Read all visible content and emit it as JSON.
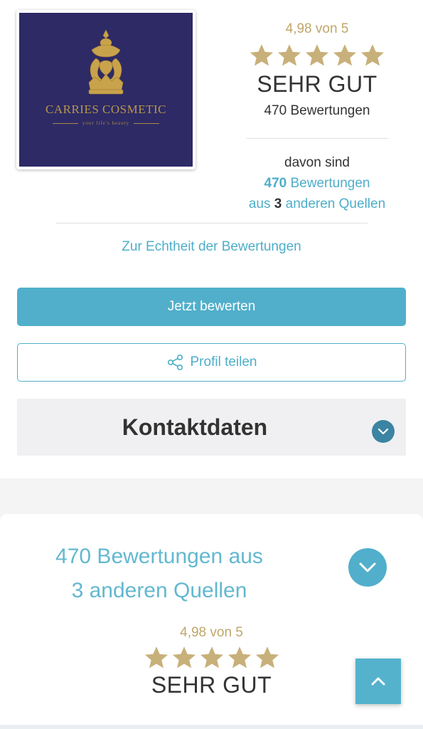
{
  "logo": {
    "brand_name": "CARRIES COSMETIC",
    "tagline": "your life's beauty",
    "accent_color": "#b8964a",
    "background_color": "#2d2a66"
  },
  "rating": {
    "score_text": "4,98 von 5",
    "stars": 5,
    "verdict": "SEHR GUT",
    "count_text": "470 Bewertungen"
  },
  "sources": {
    "intro": "davon sind",
    "count": "470",
    "reviews_word": "Bewertungen",
    "prefix": "aus",
    "source_count": "3",
    "suffix": "anderen Quellen"
  },
  "authenticity_link": "Zur Echtheit der Bewertungen",
  "buttons": {
    "rate_label": "Jetzt bewerten",
    "share_label": "Profil teilen"
  },
  "contact": {
    "title": "Kontaktdaten"
  },
  "reviews_section": {
    "heading_line1": "470 Bewertungen aus",
    "heading_line2": "3 anderen Quellen",
    "score_text": "4,98 von 5",
    "stars": 5,
    "verdict": "SEHR GUT"
  },
  "colors": {
    "accent_blue": "#51afcb",
    "star_gold": "#c8b07a",
    "chevron_dark": "#3b84a3"
  },
  "icons": {
    "share": "share-icon",
    "chevron_down": "chevron-down-icon",
    "chevron_up": "chevron-up-icon",
    "star": "star-icon"
  }
}
